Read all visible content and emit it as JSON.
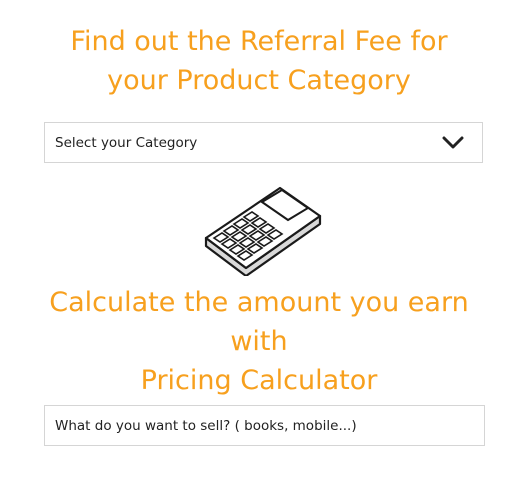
{
  "referral_section": {
    "title_line1": "Find out the Referral Fee for",
    "title_line2": "your Product Category",
    "select_label": "Select your Category",
    "select_icon": "chevron-down-icon"
  },
  "calculator_section": {
    "illustration_icon": "calculator-icon",
    "title_line1": "Calculate the amount you earn",
    "title_line2": "with",
    "title_line3": "Pricing Calculator",
    "search_placeholder": "What do you want to sell? ( books, mobile...)"
  },
  "colors": {
    "accent": "#F7A01E",
    "text": "#222222",
    "border": "#d5d5d5"
  }
}
